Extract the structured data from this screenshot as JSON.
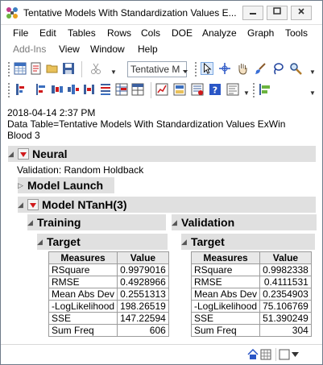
{
  "window": {
    "title": "Tentative Models With Standardization Values E..."
  },
  "menus": {
    "row1": [
      "File",
      "Edit",
      "Tables",
      "Rows",
      "Cols",
      "DOE",
      "Analyze",
      "Graph",
      "Tools"
    ],
    "row2": [
      "Add-Ins",
      "View",
      "Window",
      "Help"
    ]
  },
  "toolbar": {
    "combo_value": "Tentative M"
  },
  "report": {
    "timestamp": "2018-04-14 2:37 PM",
    "data_table_line1": "Data Table=Tentative Models With Standardization Values ExWin",
    "data_table_line2": "Blood 3",
    "platform_title": "Neural",
    "validation_method": "Validation: Random Holdback",
    "model_launch_title": "Model Launch",
    "model_title": "Model NTanH(3)",
    "training": {
      "section_title": "Training",
      "target_title": "Target",
      "headers": [
        "Measures",
        "Value"
      ],
      "rows": [
        {
          "measure": "RSquare",
          "value": "0.9979016"
        },
        {
          "measure": "RMSE",
          "value": "0.4928966"
        },
        {
          "measure": "Mean Abs Dev",
          "value": "0.2551313"
        },
        {
          "measure": "-LogLikelihood",
          "value": "198.26519"
        },
        {
          "measure": "SSE",
          "value": "147.22594"
        },
        {
          "measure": "Sum Freq",
          "value": "606"
        }
      ]
    },
    "validation": {
      "section_title": "Validation",
      "target_title": "Target",
      "headers": [
        "Measures",
        "Value"
      ],
      "rows": [
        {
          "measure": "RSquare",
          "value": "0.9982338"
        },
        {
          "measure": "RMSE",
          "value": "0.4111531"
        },
        {
          "measure": "Mean Abs Dev",
          "value": "0.2354903"
        },
        {
          "measure": "-LogLikelihood",
          "value": "75.106769"
        },
        {
          "measure": "SSE",
          "value": "51.390249"
        },
        {
          "measure": "Sum Freq",
          "value": "304"
        }
      ]
    }
  },
  "colors": {
    "red_triangle": "#d0191b",
    "outline_bg": "#e0e0e0",
    "table_border": "#9b9b9b"
  }
}
